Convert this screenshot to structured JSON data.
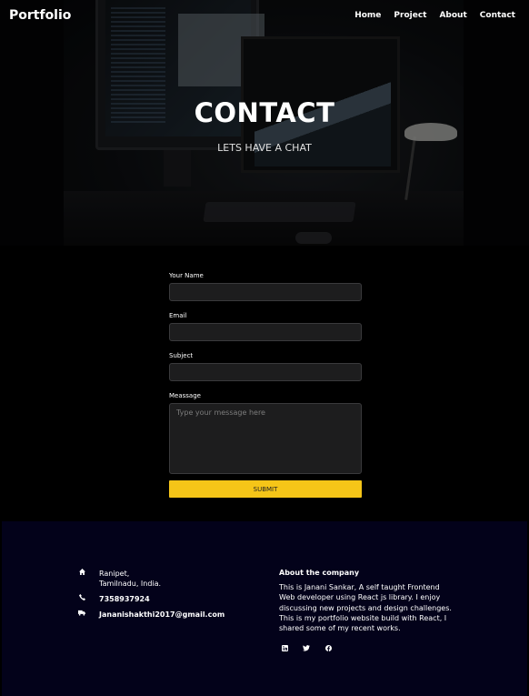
{
  "nav": {
    "brand": "Portfolio",
    "links": [
      "Home",
      "Project",
      "About",
      "Contact"
    ]
  },
  "hero": {
    "title": "CONTACT",
    "subtitle": "LETS HAVE A CHAT"
  },
  "form": {
    "name_label": "Your Name",
    "email_label": "Email",
    "subject_label": "Subject",
    "message_label": "Meassage",
    "message_placeholder": "Type your message here",
    "submit_label": "SUBMIT",
    "accent": "#f5c518"
  },
  "footer": {
    "address_line1": "Ranipet,",
    "address_line2": "Tamilnadu, India.",
    "phone": "7358937924",
    "email": "Jananishakthi2017@gmail.com",
    "about_title": "About the company",
    "about_text": "This is Janani Sankar, A self taught Frontend Web developer using React js library. I enjoy discussing new projects and design challenges. This is my portfolio website build with React, I shared some of my recent works.",
    "icons": [
      "home-icon",
      "phone-icon",
      "truck-icon"
    ],
    "socials": [
      "linkedin-icon",
      "twitter-icon",
      "facebook-icon"
    ],
    "background": "#03021a"
  }
}
